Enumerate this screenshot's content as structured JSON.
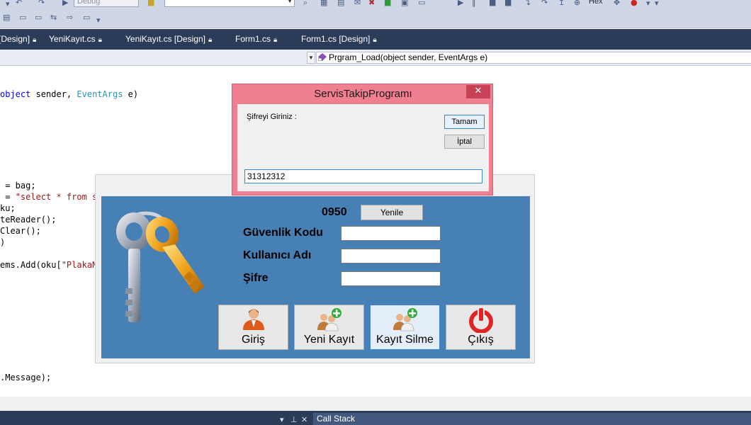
{
  "toolbar": {
    "config_select": "Debug",
    "hex_label": "Hex"
  },
  "tabs": [
    {
      "label": "[Design]"
    },
    {
      "label": "YeniKayıt.cs"
    },
    {
      "label": "YeniKayıt.cs [Design]"
    },
    {
      "label": "Form1.cs"
    },
    {
      "label": "Form1.cs [Design]"
    }
  ],
  "navbar": {
    "method": "Prgram_Load(object sender, EventArgs e)"
  },
  "code": {
    "l1_kw": "object",
    "l1_a": " sender, ",
    "l1_type": "EventArgs",
    "l1_b": " e)",
    "l2": " = bag;",
    "l3_a": " = ",
    "l3_str": "\"select * from s",
    "l4": "ku;",
    "l5": "teReader();",
    "l6": "Clear();",
    "l7": ")",
    "l8_a": "ems.Add(oku[",
    "l8_str": "\"PlakaN",
    "l9": ".Message);"
  },
  "bottom": {
    "call_stack": "Call Stack"
  },
  "mainform": {
    "code_value": "0950",
    "refresh_label": "Yenile",
    "security_label": "Güvenlik Kodu",
    "username_label": "Kullanıcı Adı",
    "password_label": "Şifre",
    "buttons": {
      "login": "Giriş",
      "new_record": "Yeni Kayıt",
      "delete_record": "Kayıt Silme",
      "exit": "Çıkış"
    }
  },
  "dialog": {
    "title": "ServisTakipProgramı",
    "close": "✕",
    "prompt": "Şifreyi Giriniz :",
    "ok": "Tamam",
    "cancel": "İptal",
    "input_value": "31312312"
  }
}
